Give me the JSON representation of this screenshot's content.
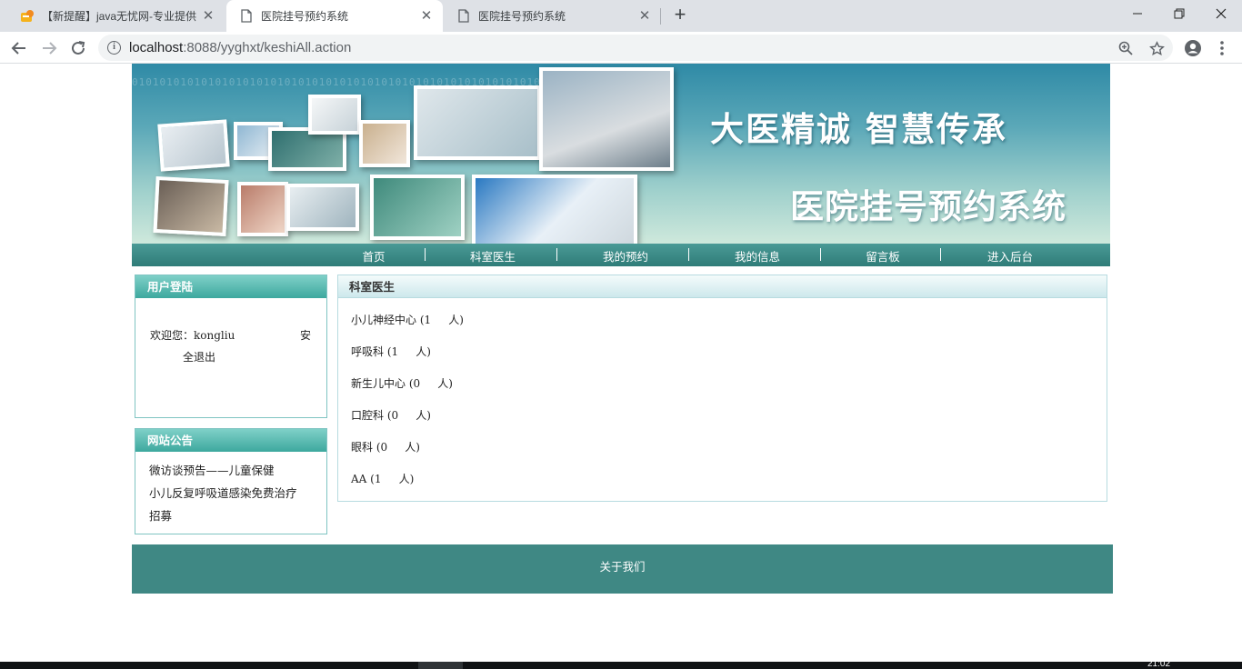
{
  "browser": {
    "tabs": [
      {
        "title": "【新提醒】java无忧网-专业提供",
        "close": "✕",
        "icon": "site-favicon-icon",
        "active": false
      },
      {
        "title": "医院挂号预约系统",
        "close": "✕",
        "icon": "page-icon",
        "active": true
      },
      {
        "title": "医院挂号预约系统",
        "close": "✕",
        "icon": "page-icon",
        "active": false
      }
    ],
    "new_tab": "+",
    "window_controls": {
      "minimize": "—",
      "maximize": "❐",
      "close": "✕"
    },
    "address": {
      "scheme": "localhost",
      "rest": ":8088/yyghxt/keshiAll.action"
    }
  },
  "site": {
    "banner": {
      "slogan": "大医精诚  智慧传承",
      "system_title": "医院挂号预约系统",
      "binary_text": "010101010101010101010101010101010101010101010101010101010101"
    },
    "nav": [
      {
        "label": "首页"
      },
      {
        "label": "科室医生"
      },
      {
        "label": "我的预约"
      },
      {
        "label": "我的信息"
      },
      {
        "label": "留言板"
      },
      {
        "label": "进入后台"
      }
    ],
    "nav_separator": "|",
    "login": {
      "title": "用户登陆",
      "welcome": "欢迎您：kongliu",
      "logout_part1": "安",
      "logout_part2": "全退出"
    },
    "notice": {
      "title": "网站公告",
      "items": [
        "微访谈预告——儿童保健",
        "小儿反复呼吸道感染免费治疗",
        "招募"
      ]
    },
    "departments": {
      "title": "科室医生",
      "items": [
        {
          "name": "小儿神经中心",
          "count": "1"
        },
        {
          "name": "呼吸科",
          "count": "1"
        },
        {
          "name": "新生儿中心",
          "count": "0"
        },
        {
          "name": "口腔科",
          "count": "0"
        },
        {
          "name": "眼科",
          "count": "0"
        },
        {
          "name": "AA",
          "count": "1"
        }
      ],
      "unit": "人"
    },
    "footer": {
      "about": "关于我们"
    }
  },
  "taskbar": {
    "clock": "21:02"
  },
  "colors": {
    "nav_bg": "#3a8a86",
    "panel_border": "#7fc4c2",
    "footer_bg": "#3f8884",
    "tabstrip_bg": "#dee1e6"
  }
}
